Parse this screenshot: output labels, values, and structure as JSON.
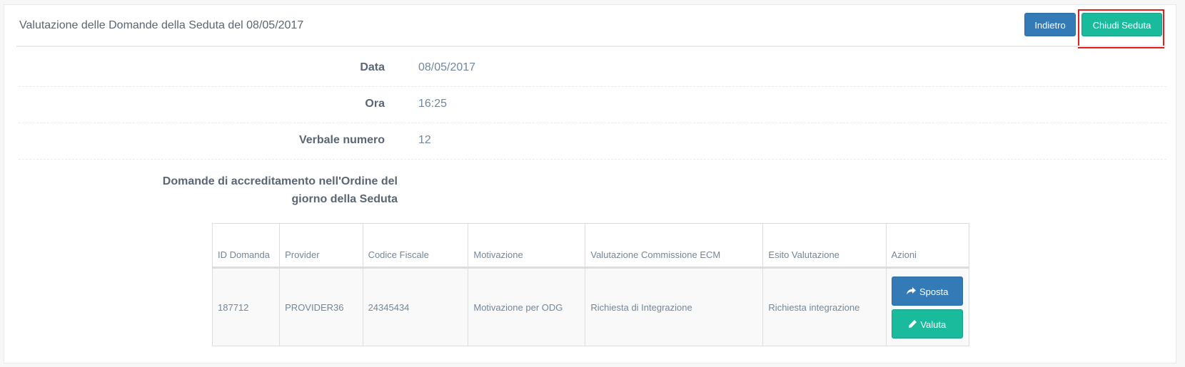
{
  "panel": {
    "title": "Valutazione delle Domande della Seduta del 08/05/2017",
    "buttons": {
      "back": "Indietro",
      "close": "Chiudi Seduta"
    }
  },
  "fields": [
    {
      "label": "Data",
      "value": "08/05/2017"
    },
    {
      "label": "Ora",
      "value": "16:25"
    },
    {
      "label": "Verbale numero",
      "value": "12"
    }
  ],
  "domande_label": "Domande di accreditamento nell'Ordine del giorno della Seduta",
  "table": {
    "headers": [
      "ID Domanda",
      "Provider",
      "Codice Fiscale",
      "Motivazione",
      "Valutazione Commissione ECM",
      "Esito Valutazione",
      "Azioni"
    ],
    "rows": [
      {
        "id": "187712",
        "provider": "PROVIDER36",
        "codice_fiscale": "24345434",
        "motivazione": "Motivazione per ODG",
        "valutazione": "Richiesta di Integrazione",
        "esito": "Richiesta integrazione",
        "actions": {
          "sposta": "Sposta",
          "valuta": "Valuta"
        }
      }
    ]
  },
  "icons": {
    "sposta": "share-arrow-icon",
    "valuta": "pencil-icon"
  },
  "colors": {
    "primary": "#337ab7",
    "success": "#1abb9c",
    "highlight": "#e02020"
  }
}
